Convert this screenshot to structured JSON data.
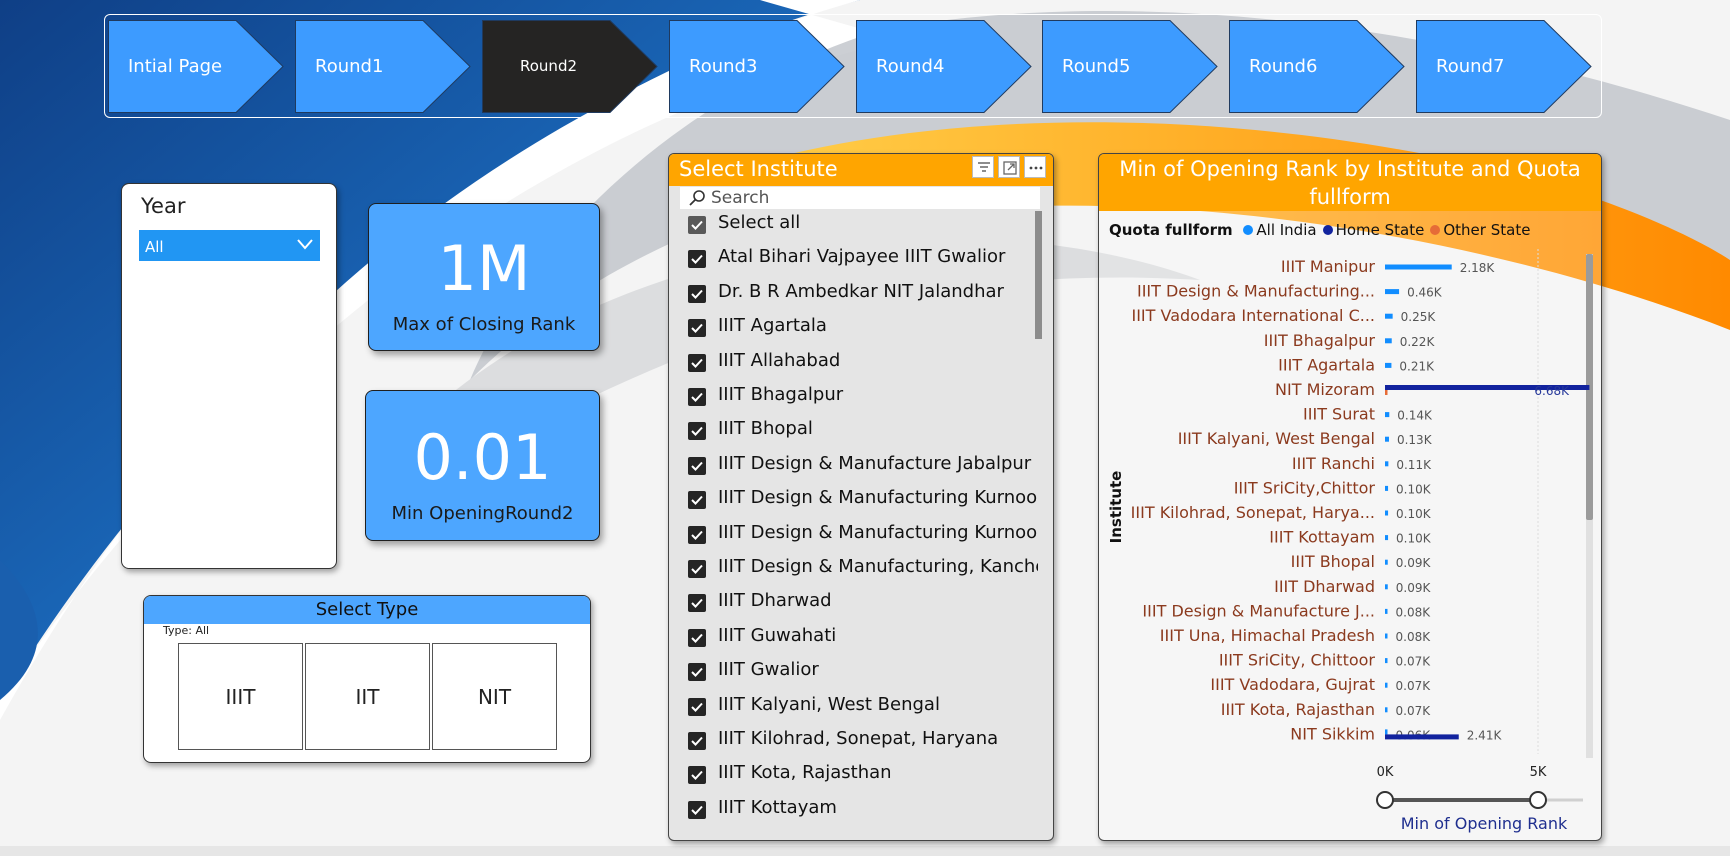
{
  "nav": {
    "items": [
      {
        "label": "Intial Page",
        "active": false
      },
      {
        "label": "Round1",
        "active": false
      },
      {
        "label": "Round2",
        "active": true
      },
      {
        "label": "Round3",
        "active": false
      },
      {
        "label": "Round4",
        "active": false
      },
      {
        "label": "Round5",
        "active": false
      },
      {
        "label": "Round6",
        "active": false
      },
      {
        "label": "Round7",
        "active": false
      }
    ]
  },
  "year_slicer": {
    "title": "Year",
    "selected": "All"
  },
  "kpis": [
    {
      "value": "1M",
      "label": "Max of Closing Rank"
    },
    {
      "value": "0.01",
      "label": "Min OpeningRound2"
    }
  ],
  "type_slicer": {
    "title": "Select Type",
    "subtitle": "Type: All",
    "options": [
      "IIIT",
      "IIT",
      "NIT"
    ]
  },
  "institute_slicer": {
    "title": "Select Institute",
    "search_placeholder": "Search",
    "items": [
      "Select all",
      "Atal Bihari Vajpayee IIIT Gwalior",
      "Dr. B R Ambedkar NIT Jalandhar",
      "IIIT Agartala",
      "IIIT Allahabad",
      "IIIT Bhagalpur",
      "IIIT Bhopal",
      "IIIT Design & Manufacture Jabalpur",
      "IIIT Design & Manufacturing Kurnool",
      "IIIT Design & Manufacturing Kurnool,...",
      "IIIT Design & Manufacturing, Kanche...",
      "IIIT Dharwad",
      "IIIT Guwahati",
      "IIIT Gwalior",
      "IIIT Kalyani, West Bengal",
      "IIIT Kilohrad, Sonepat, Haryana",
      "IIIT Kota, Rajasthan",
      "IIIT Kottayam"
    ]
  },
  "chart": {
    "title": "Min of Opening Rank by Institute and Quota fullform",
    "legend_title": "Quota fullform",
    "ylabel": "Institute",
    "xlabel": "Min of Opening Rank",
    "slider_min_label": "0K",
    "slider_max_label": "5K"
  },
  "chart_data": {
    "type": "bar",
    "orientation": "horizontal",
    "title": "Min of Opening Rank by Institute and Quota fullform",
    "xlabel": "Min of Opening Rank",
    "ylabel": "Institute",
    "xlim": [
      0,
      6000
    ],
    "legend": {
      "title": "Quota fullform",
      "position": "top-left"
    },
    "colors": {
      "All India": "#118dff",
      "Home State": "#12239e",
      "Other State": "#e66c37"
    },
    "categories": [
      "IIIT Manipur",
      "IIIT Design & Manufacturing...",
      "IIIT Vadodara International C...",
      "IIIT Bhagalpur",
      "IIIT Agartala",
      "NIT Mizoram",
      "IIIT Surat",
      "IIIT Kalyani, West Bengal",
      "IIIT Ranchi",
      "IIIT SriCity,Chittor",
      "IIIT Kilohrad, Sonepat, Harya...",
      "IIIT Kottayam",
      "IIIT Bhopal",
      "IIIT Dharwad",
      "IIIT Design & Manufacture J...",
      "IIIT Una, Himachal Pradesh",
      "IIIT SriCity, Chittoor",
      "IIIT Vadodara, Gujrat",
      "IIIT Kota, Rajasthan",
      "NIT Sikkim"
    ],
    "series": [
      {
        "name": "All India",
        "values": [
          2180,
          460,
          250,
          220,
          210,
          null,
          140,
          130,
          110,
          100,
          100,
          100,
          90,
          90,
          80,
          80,
          70,
          70,
          70,
          60
        ],
        "labels": [
          "2.18K",
          "0.46K",
          "0.25K",
          "0.22K",
          "0.21K",
          "",
          "0.14K",
          "0.13K",
          "0.11K",
          "0.10K",
          "0.10K",
          "0.10K",
          "0.09K",
          "0.09K",
          "0.08K",
          "0.08K",
          "0.07K",
          "0.07K",
          "0.07K",
          "0.06K"
        ]
      },
      {
        "name": "Home State",
        "values": [
          null,
          null,
          null,
          null,
          null,
          6680,
          null,
          null,
          null,
          null,
          null,
          null,
          null,
          null,
          null,
          null,
          null,
          null,
          null,
          2410
        ],
        "labels": [
          "",
          "",
          "",
          "",
          "",
          "6.68K",
          "",
          "",
          "",
          "",
          "",
          "",
          "",
          "",
          "",
          "",
          "",
          "",
          "",
          "2.41K"
        ]
      },
      {
        "name": "Other State",
        "values": [
          null,
          null,
          null,
          null,
          null,
          30,
          null,
          null,
          null,
          null,
          null,
          null,
          null,
          null,
          null,
          null,
          null,
          null,
          null,
          null
        ],
        "labels": [
          "",
          "",
          "",
          "",
          "",
          "",
          "",
          "",
          "",
          "",
          "",
          "",
          "",
          "",
          "",
          "",
          "",
          "",
          "",
          ""
        ]
      }
    ]
  }
}
